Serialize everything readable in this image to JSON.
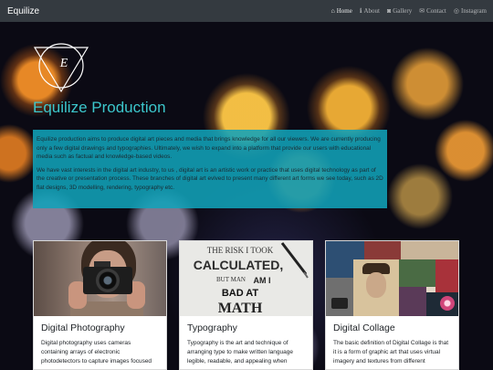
{
  "navbar": {
    "brand": "Equilize",
    "links": [
      {
        "icon": "home-icon",
        "glyph": "⌂",
        "label": "Home"
      },
      {
        "icon": "info-icon",
        "glyph": "ℹ",
        "label": "About"
      },
      {
        "icon": "camera-icon",
        "glyph": "◙",
        "label": "Gallery"
      },
      {
        "icon": "envelope-icon",
        "glyph": "✉",
        "label": "Contact"
      },
      {
        "icon": "instagram-icon",
        "glyph": "◎",
        "label": "Instagram"
      }
    ]
  },
  "hero": {
    "logo_letter": "E",
    "title": "Equilize Production",
    "paragraphs": [
      "Equilize production aims to produce digital art pieces and media that brings knowledge for all our viewers. We are currently producing only a few digital drawings and typographies. Ultimately, we wish to expand into a platform that provide our users with educational media such as factual and knowledge-based videos.",
      "We have vast interests in the digital art industry, to us , digital art is an artistic work or practice that uses digital technology as part of the creative or presentation process. These branches of digital art evlved to present many different art forms we see today, such as 2D flat designs, 3D modelling, rendering, typography etc."
    ]
  },
  "cards": [
    {
      "title": "Digital Photography",
      "text": "Digital photography uses cameras containing arrays of electronic photodetectors to capture images focused"
    },
    {
      "title": "Typography",
      "text": "Typography is the art and technique of arranging type to make written language legible, readable, and appealing when",
      "image_text": [
        "THE RISK I TOOK",
        "CALCULATED,",
        "BUT MAN",
        "AM I",
        "BAD AT",
        "MATH"
      ]
    },
    {
      "title": "Digital Collage",
      "text": "The basic definition of Digital Collage is that it is a form of graphic art that uses virtual imagery and textures from different"
    }
  ],
  "colors": {
    "navbar_bg": "#343a40",
    "title_accent": "#3cc7cc",
    "intro_box": "#11a2b8"
  }
}
